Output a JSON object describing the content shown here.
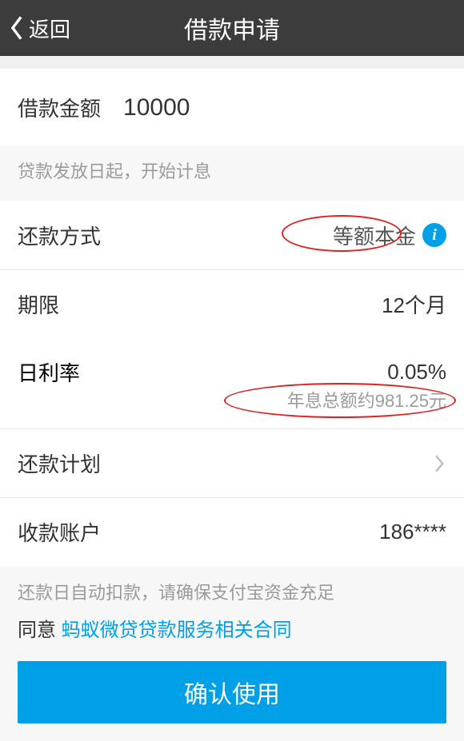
{
  "header": {
    "back_label": "返回",
    "title": "借款申请"
  },
  "amount": {
    "label": "借款金额",
    "value": "10000"
  },
  "hint_start": "贷款发放日起，开始计息",
  "repay_method": {
    "label": "还款方式",
    "value": "等额本金"
  },
  "term": {
    "label": "期限",
    "value": "12个月"
  },
  "rate": {
    "label": "日利率",
    "value": "0.05%",
    "extra": "年息总额约981.25元"
  },
  "plan": {
    "label": "还款计划"
  },
  "account": {
    "label": "收款账户",
    "value": "186****"
  },
  "footer": {
    "hint": "还款日自动扣款，请确保支付宝资金充足",
    "agree_prefix": "同意 ",
    "agree_link": "蚂蚁微贷贷款服务相关合同",
    "confirm": "确认使用"
  }
}
